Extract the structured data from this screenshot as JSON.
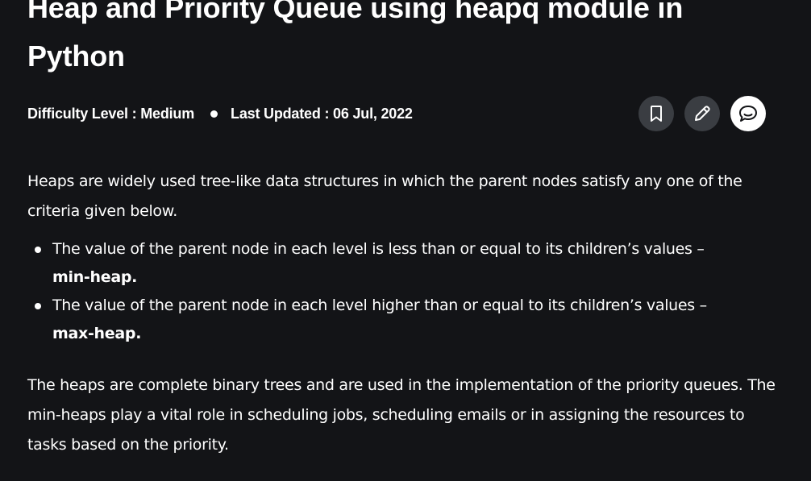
{
  "article": {
    "title": "Heap and Priority Queue using heapq module in Python",
    "difficulty": "Difficulty Level : Medium",
    "last_updated": "Last Updated : 06 Jul, 2022",
    "intro": "Heaps are widely used tree-like data structures in which the parent nodes satisfy any one of the criteria given below.",
    "bullets": [
      {
        "text": "The value of the parent node in each level is less than or equal to its children’s values –",
        "bold": "min-heap."
      },
      {
        "text": "The value of the parent node in each level higher than or equal to its children’s values –",
        "bold": "max-heap."
      }
    ],
    "paragraph2": "The heaps are complete binary trees and are used in the implementation of the priority queues. The min-heaps play a vital role in scheduling jobs, scheduling emails or in assigning the resources to tasks based on the priority."
  },
  "actions": {
    "bookmark_icon": "bookmark-icon",
    "edit_icon": "pencil-icon",
    "discuss_icon": "chat-bubble-icon"
  },
  "colors": {
    "background": "#131417",
    "text": "#ffffff",
    "icon_button_dark": "#3a3d42",
    "icon_button_light": "#ffffff"
  }
}
